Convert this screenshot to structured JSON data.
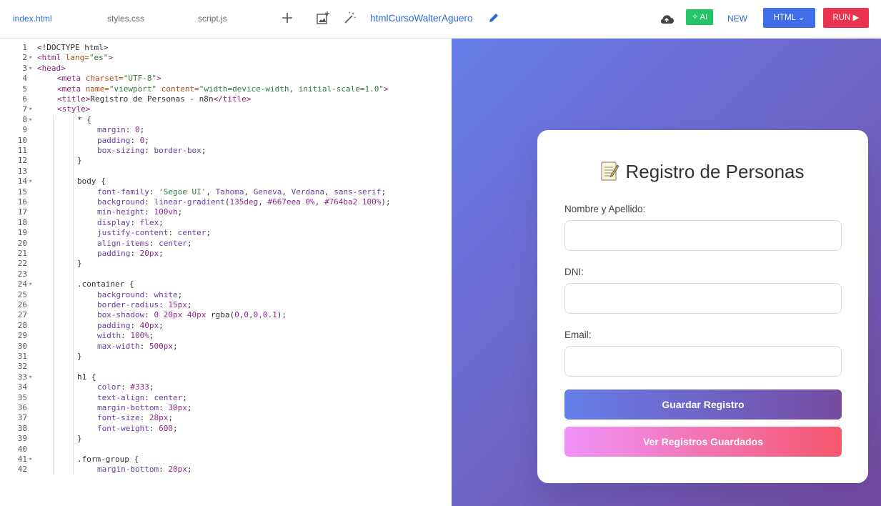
{
  "tabs": [
    "index.html",
    "styles.css",
    "script.js"
  ],
  "toolbar": {
    "project_name": "htmlCursoWalterAguero",
    "ai_label": "AI",
    "new_label": "NEW",
    "html_label": "HTML",
    "run_label": "RUN"
  },
  "editor": {
    "lines": [
      {
        "n": "1",
        "fold": "",
        "indent": 0,
        "segs": [
          [
            "t-plain",
            "<!DOCTYPE html>"
          ]
        ]
      },
      {
        "n": "2",
        "fold": "▾",
        "indent": 0,
        "segs": [
          [
            "t-tag",
            "<html "
          ],
          [
            "t-attr",
            "lang="
          ],
          [
            "t-str",
            "\"es\""
          ],
          [
            "t-tag",
            ">"
          ]
        ]
      },
      {
        "n": "3",
        "fold": "▾",
        "indent": 0,
        "segs": [
          [
            "t-tag",
            "<head>"
          ]
        ]
      },
      {
        "n": "4",
        "fold": "",
        "indent": 1,
        "segs": [
          [
            "t-tag",
            "<meta "
          ],
          [
            "t-attr",
            "charset="
          ],
          [
            "t-str",
            "\"UTF-8\""
          ],
          [
            "t-tag",
            ">"
          ]
        ]
      },
      {
        "n": "5",
        "fold": "",
        "indent": 1,
        "segs": [
          [
            "t-tag",
            "<meta "
          ],
          [
            "t-attr",
            "name="
          ],
          [
            "t-str",
            "\"viewport\""
          ],
          [
            "t-attr",
            " content="
          ],
          [
            "t-str",
            "\"width=device-width, initial-scale=1.0\""
          ],
          [
            "t-tag",
            ">"
          ]
        ]
      },
      {
        "n": "6",
        "fold": "",
        "indent": 1,
        "segs": [
          [
            "t-tag",
            "<title>"
          ],
          [
            "t-plain",
            "Registro de Personas - n8n"
          ],
          [
            "t-tag",
            "</title>"
          ]
        ]
      },
      {
        "n": "7",
        "fold": "▾",
        "indent": 1,
        "segs": [
          [
            "t-tag",
            "<style>"
          ]
        ]
      },
      {
        "n": "8",
        "fold": "▾",
        "indent": 2,
        "segs": [
          [
            "t-plain",
            "* {"
          ]
        ]
      },
      {
        "n": "9",
        "fold": "",
        "indent": 3,
        "segs": [
          [
            "t-prop",
            "margin"
          ],
          [
            "t-plain",
            ": "
          ],
          [
            "t-num",
            "0"
          ],
          [
            "t-plain",
            ";"
          ]
        ]
      },
      {
        "n": "10",
        "fold": "",
        "indent": 3,
        "segs": [
          [
            "t-prop",
            "padding"
          ],
          [
            "t-plain",
            ": "
          ],
          [
            "t-num",
            "0"
          ],
          [
            "t-plain",
            ";"
          ]
        ]
      },
      {
        "n": "11",
        "fold": "",
        "indent": 3,
        "segs": [
          [
            "t-prop",
            "box-sizing"
          ],
          [
            "t-plain",
            ": "
          ],
          [
            "t-prop",
            "border-box"
          ],
          [
            "t-plain",
            ";"
          ]
        ]
      },
      {
        "n": "12",
        "fold": "",
        "indent": 2,
        "segs": [
          [
            "t-plain",
            "}"
          ]
        ]
      },
      {
        "n": "13",
        "fold": "",
        "indent": 0,
        "segs": []
      },
      {
        "n": "14",
        "fold": "▾",
        "indent": 2,
        "segs": [
          [
            "t-plain",
            "body {"
          ]
        ]
      },
      {
        "n": "15",
        "fold": "",
        "indent": 3,
        "segs": [
          [
            "t-prop",
            "font-family"
          ],
          [
            "t-plain",
            ": "
          ],
          [
            "t-str",
            "'Segoe UI'"
          ],
          [
            "t-plain",
            ", "
          ],
          [
            "t-prop",
            "Tahoma"
          ],
          [
            "t-plain",
            ", "
          ],
          [
            "t-prop",
            "Geneva"
          ],
          [
            "t-plain",
            ", "
          ],
          [
            "t-prop",
            "Verdana"
          ],
          [
            "t-plain",
            ", "
          ],
          [
            "t-prop",
            "sans-serif"
          ],
          [
            "t-plain",
            ";"
          ]
        ]
      },
      {
        "n": "16",
        "fold": "",
        "indent": 3,
        "segs": [
          [
            "t-prop",
            "background"
          ],
          [
            "t-plain",
            ": "
          ],
          [
            "t-prop",
            "linear-gradient"
          ],
          [
            "t-plain",
            "("
          ],
          [
            "t-num",
            "135deg"
          ],
          [
            "t-plain",
            ", "
          ],
          [
            "t-num",
            "#667eea"
          ],
          [
            "t-plain",
            " "
          ],
          [
            "t-num",
            "0%"
          ],
          [
            "t-plain",
            ", "
          ],
          [
            "t-num",
            "#764ba2"
          ],
          [
            "t-plain",
            " "
          ],
          [
            "t-num",
            "100%"
          ],
          [
            "t-plain",
            ");"
          ]
        ]
      },
      {
        "n": "17",
        "fold": "",
        "indent": 3,
        "segs": [
          [
            "t-prop",
            "min-height"
          ],
          [
            "t-plain",
            ": "
          ],
          [
            "t-num",
            "100vh"
          ],
          [
            "t-plain",
            ";"
          ]
        ]
      },
      {
        "n": "18",
        "fold": "",
        "indent": 3,
        "segs": [
          [
            "t-prop",
            "display"
          ],
          [
            "t-plain",
            ": "
          ],
          [
            "t-prop",
            "flex"
          ],
          [
            "t-plain",
            ";"
          ]
        ]
      },
      {
        "n": "19",
        "fold": "",
        "indent": 3,
        "segs": [
          [
            "t-prop",
            "justify-content"
          ],
          [
            "t-plain",
            ": "
          ],
          [
            "t-prop",
            "center"
          ],
          [
            "t-plain",
            ";"
          ]
        ]
      },
      {
        "n": "20",
        "fold": "",
        "indent": 3,
        "segs": [
          [
            "t-prop",
            "align-items"
          ],
          [
            "t-plain",
            ": "
          ],
          [
            "t-prop",
            "center"
          ],
          [
            "t-plain",
            ";"
          ]
        ]
      },
      {
        "n": "21",
        "fold": "",
        "indent": 3,
        "segs": [
          [
            "t-prop",
            "padding"
          ],
          [
            "t-plain",
            ": "
          ],
          [
            "t-num",
            "20px"
          ],
          [
            "t-plain",
            ";"
          ]
        ]
      },
      {
        "n": "22",
        "fold": "",
        "indent": 2,
        "segs": [
          [
            "t-plain",
            "}"
          ]
        ]
      },
      {
        "n": "23",
        "fold": "",
        "indent": 0,
        "segs": []
      },
      {
        "n": "24",
        "fold": "▾",
        "indent": 2,
        "segs": [
          [
            "t-plain",
            ".container {"
          ]
        ]
      },
      {
        "n": "25",
        "fold": "",
        "indent": 3,
        "segs": [
          [
            "t-prop",
            "background"
          ],
          [
            "t-plain",
            ": "
          ],
          [
            "t-prop",
            "white"
          ],
          [
            "t-plain",
            ";"
          ]
        ]
      },
      {
        "n": "26",
        "fold": "",
        "indent": 3,
        "segs": [
          [
            "t-prop",
            "border-radius"
          ],
          [
            "t-plain",
            ": "
          ],
          [
            "t-num",
            "15px"
          ],
          [
            "t-plain",
            ";"
          ]
        ]
      },
      {
        "n": "27",
        "fold": "",
        "indent": 3,
        "segs": [
          [
            "t-prop",
            "box-shadow"
          ],
          [
            "t-plain",
            ": "
          ],
          [
            "t-num",
            "0 20px 40px"
          ],
          [
            "t-plain",
            " rgba("
          ],
          [
            "t-num",
            "0,0,0,0.1"
          ],
          [
            "t-plain",
            ");"
          ]
        ]
      },
      {
        "n": "28",
        "fold": "",
        "indent": 3,
        "segs": [
          [
            "t-prop",
            "padding"
          ],
          [
            "t-plain",
            ": "
          ],
          [
            "t-num",
            "40px"
          ],
          [
            "t-plain",
            ";"
          ]
        ]
      },
      {
        "n": "29",
        "fold": "",
        "indent": 3,
        "segs": [
          [
            "t-prop",
            "width"
          ],
          [
            "t-plain",
            ": "
          ],
          [
            "t-num",
            "100%"
          ],
          [
            "t-plain",
            ";"
          ]
        ]
      },
      {
        "n": "30",
        "fold": "",
        "indent": 3,
        "segs": [
          [
            "t-prop",
            "max-width"
          ],
          [
            "t-plain",
            ": "
          ],
          [
            "t-num",
            "500px"
          ],
          [
            "t-plain",
            ";"
          ]
        ]
      },
      {
        "n": "31",
        "fold": "",
        "indent": 2,
        "segs": [
          [
            "t-plain",
            "}"
          ]
        ]
      },
      {
        "n": "32",
        "fold": "",
        "indent": 0,
        "segs": []
      },
      {
        "n": "33",
        "fold": "▾",
        "indent": 2,
        "segs": [
          [
            "t-plain",
            "h1 {"
          ]
        ]
      },
      {
        "n": "34",
        "fold": "",
        "indent": 3,
        "segs": [
          [
            "t-prop",
            "color"
          ],
          [
            "t-plain",
            ": "
          ],
          [
            "t-num",
            "#333"
          ],
          [
            "t-plain",
            ";"
          ]
        ]
      },
      {
        "n": "35",
        "fold": "",
        "indent": 3,
        "segs": [
          [
            "t-prop",
            "text-align"
          ],
          [
            "t-plain",
            ": "
          ],
          [
            "t-prop",
            "center"
          ],
          [
            "t-plain",
            ";"
          ]
        ]
      },
      {
        "n": "36",
        "fold": "",
        "indent": 3,
        "segs": [
          [
            "t-prop",
            "margin-bottom"
          ],
          [
            "t-plain",
            ": "
          ],
          [
            "t-num",
            "30px"
          ],
          [
            "t-plain",
            ";"
          ]
        ]
      },
      {
        "n": "37",
        "fold": "",
        "indent": 3,
        "segs": [
          [
            "t-prop",
            "font-size"
          ],
          [
            "t-plain",
            ": "
          ],
          [
            "t-num",
            "28px"
          ],
          [
            "t-plain",
            ";"
          ]
        ]
      },
      {
        "n": "38",
        "fold": "",
        "indent": 3,
        "segs": [
          [
            "t-prop",
            "font-weight"
          ],
          [
            "t-plain",
            ": "
          ],
          [
            "t-num",
            "600"
          ],
          [
            "t-plain",
            ";"
          ]
        ]
      },
      {
        "n": "39",
        "fold": "",
        "indent": 2,
        "segs": [
          [
            "t-plain",
            "}"
          ]
        ]
      },
      {
        "n": "40",
        "fold": "",
        "indent": 0,
        "segs": []
      },
      {
        "n": "41",
        "fold": "▾",
        "indent": 2,
        "segs": [
          [
            "t-plain",
            ".form-group {"
          ]
        ]
      },
      {
        "n": "42",
        "fold": "",
        "indent": 3,
        "segs": [
          [
            "t-prop",
            "margin-bottom"
          ],
          [
            "t-plain",
            ": "
          ],
          [
            "t-num",
            "20px"
          ],
          [
            "t-plain",
            ";"
          ]
        ]
      }
    ]
  },
  "preview": {
    "title": "Registro de Personas",
    "fields": [
      {
        "label": "Nombre y Apellido:",
        "value": ""
      },
      {
        "label": "DNI:",
        "value": ""
      },
      {
        "label": "Email:",
        "value": ""
      }
    ],
    "save_button": "Guardar Registro",
    "view_button": "Ver Registros Guardados"
  }
}
